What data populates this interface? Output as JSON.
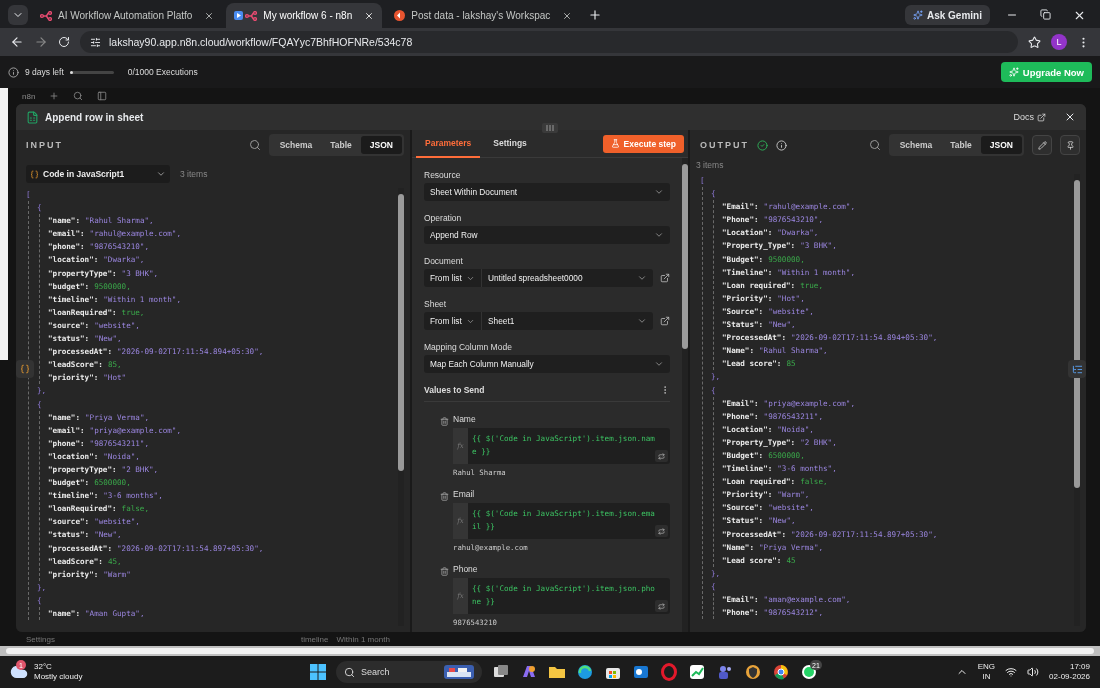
{
  "browser": {
    "tabs": [
      {
        "title": "AI Workflow Automation Platfo",
        "selected": false
      },
      {
        "title": "My workflow 6 - n8n",
        "selected": true
      },
      {
        "title": "Post data - lakshay's Workspac",
        "selected": false
      }
    ],
    "url": "lakshay90.app.n8n.cloud/workflow/FQAYyc7BhfHOFNRe/534c78",
    "ask": "Ask Gemini",
    "profile": "L"
  },
  "trial": {
    "days_left": "9 days left",
    "level": 0,
    "executions": "0/1000 Executions",
    "upgrade": "Upgrade Now"
  },
  "canvas": {
    "logo": "n8n",
    "settings": "Settings",
    "row_key": "timeline",
    "row_value": "Within 1 month"
  },
  "modal": {
    "title": "Append row in sheet",
    "docs": "Docs",
    "input": {
      "label": "INPUT",
      "views": [
        {
          "label": "Schema",
          "selected": false
        },
        {
          "label": "Table",
          "selected": false
        },
        {
          "label": "JSON",
          "selected": true
        }
      ],
      "source": "Code in JavaScript1",
      "count": "3 items",
      "json": {
        "open": "[",
        "objects": [
          {
            "open": "{",
            "close": "},",
            "fields": [
              {
                "key": "\"name\":",
                "value": "\"Rahul Sharma\",",
                "kind": "string"
              },
              {
                "key": "\"email\":",
                "value": "\"rahul@example.com\",",
                "kind": "string"
              },
              {
                "key": "\"phone\":",
                "value": "\"9876543210\",",
                "kind": "string"
              },
              {
                "key": "\"location\":",
                "value": "\"Dwarka\",",
                "kind": "string"
              },
              {
                "key": "\"propertyType\":",
                "value": "\"3 BHK\",",
                "kind": "string"
              },
              {
                "key": "\"budget\":",
                "value": "9500000,",
                "kind": "number"
              },
              {
                "key": "\"timeline\":",
                "value": "\"Within 1 month\",",
                "kind": "string"
              },
              {
                "key": "\"loanRequired\":",
                "value": "true,",
                "kind": "boolean"
              },
              {
                "key": "\"source\":",
                "value": "\"website\",",
                "kind": "string"
              },
              {
                "key": "\"status\":",
                "value": "\"New\",",
                "kind": "string"
              },
              {
                "key": "\"processedAt\":",
                "value": "\"2026-09-02T17:11:54.894+05:30\",",
                "kind": "string"
              },
              {
                "key": "\"leadScore\":",
                "value": "85,",
                "kind": "number"
              },
              {
                "key": "\"priority\":",
                "value": "\"Hot\"",
                "kind": "string"
              }
            ]
          },
          {
            "open": "{",
            "close": "},",
            "fields": [
              {
                "key": "\"name\":",
                "value": "\"Priya Verma\",",
                "kind": "string"
              },
              {
                "key": "\"email\":",
                "value": "\"priya@example.com\",",
                "kind": "string"
              },
              {
                "key": "\"phone\":",
                "value": "\"9876543211\",",
                "kind": "string"
              },
              {
                "key": "\"location\":",
                "value": "\"Noida\",",
                "kind": "string"
              },
              {
                "key": "\"propertyType\":",
                "value": "\"2 BHK\",",
                "kind": "string"
              },
              {
                "key": "\"budget\":",
                "value": "6500000,",
                "kind": "number"
              },
              {
                "key": "\"timeline\":",
                "value": "\"3-6 months\",",
                "kind": "string"
              },
              {
                "key": "\"loanRequired\":",
                "value": "false,",
                "kind": "boolean"
              },
              {
                "key": "\"source\":",
                "value": "\"website\",",
                "kind": "string"
              },
              {
                "key": "\"status\":",
                "value": "\"New\",",
                "kind": "string"
              },
              {
                "key": "\"processedAt\":",
                "value": "\"2026-09-02T17:11:54.897+05:30\",",
                "kind": "string"
              },
              {
                "key": "\"leadScore\":",
                "value": "45,",
                "kind": "number"
              },
              {
                "key": "\"priority\":",
                "value": "\"Warm\"",
                "kind": "string"
              }
            ]
          },
          {
            "open": "{",
            "fields": [
              {
                "key": "\"name\":",
                "value": "\"Aman Gupta\",",
                "kind": "string"
              }
            ]
          }
        ]
      }
    },
    "parameters": {
      "tabs": [
        {
          "label": "Parameters",
          "selected": true
        },
        {
          "label": "Settings",
          "selected": false
        }
      ],
      "execute": "Execute step",
      "fields": [
        {
          "kind": "select",
          "label": "Resource",
          "value": "Sheet Within Document"
        },
        {
          "kind": "select",
          "label": "Operation",
          "value": "Append Row"
        },
        {
          "kind": "locator",
          "label": "Document",
          "mode": "From list",
          "value": "Untitled spreadsheet0000"
        },
        {
          "kind": "locator",
          "label": "Sheet",
          "mode": "From list",
          "value": "Sheet1"
        },
        {
          "kind": "select",
          "label": "Mapping Column Mode",
          "value": "Map Each Column Manually"
        }
      ],
      "values_title": "Values to Send",
      "mappings": [
        {
          "label": "Name",
          "fx": "fx",
          "expression": "{{ $('Code in JavaScript').item.json.name }}",
          "preview": "Rahul Sharma"
        },
        {
          "label": "Email",
          "fx": "fx",
          "expression": "{{ $('Code in JavaScript').item.json.email }}",
          "preview": "rahul@example.com"
        },
        {
          "label": "Phone",
          "fx": "fx",
          "expression": "{{ $('Code in JavaScript').item.json.phone }}",
          "preview": "9876543210"
        }
      ]
    },
    "output": {
      "label": "OUTPUT",
      "views": [
        {
          "label": "Schema",
          "selected": false
        },
        {
          "label": "Table",
          "selected": false
        },
        {
          "label": "JSON",
          "selected": true
        }
      ],
      "count": "3 items",
      "json": {
        "open": "[",
        "objects": [
          {
            "open": "{",
            "close": "},",
            "fields": [
              {
                "key": "\"Email\":",
                "value": "\"rahul@example.com\",",
                "kind": "string"
              },
              {
                "key": "\"Phone\":",
                "value": "\"9876543210\",",
                "kind": "string"
              },
              {
                "key": "\"Location\":",
                "value": "\"Dwarka\",",
                "kind": "string"
              },
              {
                "key": "\"Property_Type\":",
                "value": "\"3 BHK\",",
                "kind": "string"
              },
              {
                "key": "\"Budget\":",
                "value": "9500000,",
                "kind": "number"
              },
              {
                "key": "\"Timeline\":",
                "value": "\"Within 1 month\",",
                "kind": "string"
              },
              {
                "key": "\"Loan required\":",
                "value": "true,",
                "kind": "boolean"
              },
              {
                "key": "\"Priority\":",
                "value": "\"Hot\",",
                "kind": "string"
              },
              {
                "key": "\"Source\":",
                "value": "\"website\",",
                "kind": "string"
              },
              {
                "key": "\"Status\":",
                "value": "\"New\",",
                "kind": "string"
              },
              {
                "key": "\"ProcessedAt\":",
                "value": "\"2026-09-02T17:11:54.894+05:30\",",
                "kind": "string"
              },
              {
                "key": "\"Name\":",
                "value": "\"Rahul Sharma\",",
                "kind": "string"
              },
              {
                "key": "\"Lead score\":",
                "value": "85",
                "kind": "number"
              }
            ]
          },
          {
            "open": "{",
            "close": "},",
            "fields": [
              {
                "key": "\"Email\":",
                "value": "\"priya@example.com\",",
                "kind": "string"
              },
              {
                "key": "\"Phone\":",
                "value": "\"9876543211\",",
                "kind": "string"
              },
              {
                "key": "\"Location\":",
                "value": "\"Noida\",",
                "kind": "string"
              },
              {
                "key": "\"Property_Type\":",
                "value": "\"2 BHK\",",
                "kind": "string"
              },
              {
                "key": "\"Budget\":",
                "value": "6500000,",
                "kind": "number"
              },
              {
                "key": "\"Timeline\":",
                "value": "\"3-6 months\",",
                "kind": "string"
              },
              {
                "key": "\"Loan required\":",
                "value": "false,",
                "kind": "boolean"
              },
              {
                "key": "\"Priority\":",
                "value": "\"Warm\",",
                "kind": "string"
              },
              {
                "key": "\"Source\":",
                "value": "\"website\",",
                "kind": "string"
              },
              {
                "key": "\"Status\":",
                "value": "\"New\",",
                "kind": "string"
              },
              {
                "key": "\"ProcessedAt\":",
                "value": "\"2026-09-02T17:11:54.897+05:30\",",
                "kind": "string"
              },
              {
                "key": "\"Name\":",
                "value": "\"Priya Verma\",",
                "kind": "string"
              },
              {
                "key": "\"Lead score\":",
                "value": "45",
                "kind": "number"
              }
            ]
          },
          {
            "open": "{",
            "fields": [
              {
                "key": "\"Email\":",
                "value": "\"aman@example.com\",",
                "kind": "string"
              },
              {
                "key": "\"Phone\":",
                "value": "\"9876543212\",",
                "kind": "string"
              }
            ]
          }
        ]
      }
    }
  },
  "taskbar": {
    "weather_badge": "1",
    "temperature": "32°C",
    "weather": "Mostly cloudy",
    "search": "Search",
    "chat_badge": "21",
    "language": "ENG",
    "region": "IN",
    "time": "17:09",
    "date": "02-09-2026"
  }
}
